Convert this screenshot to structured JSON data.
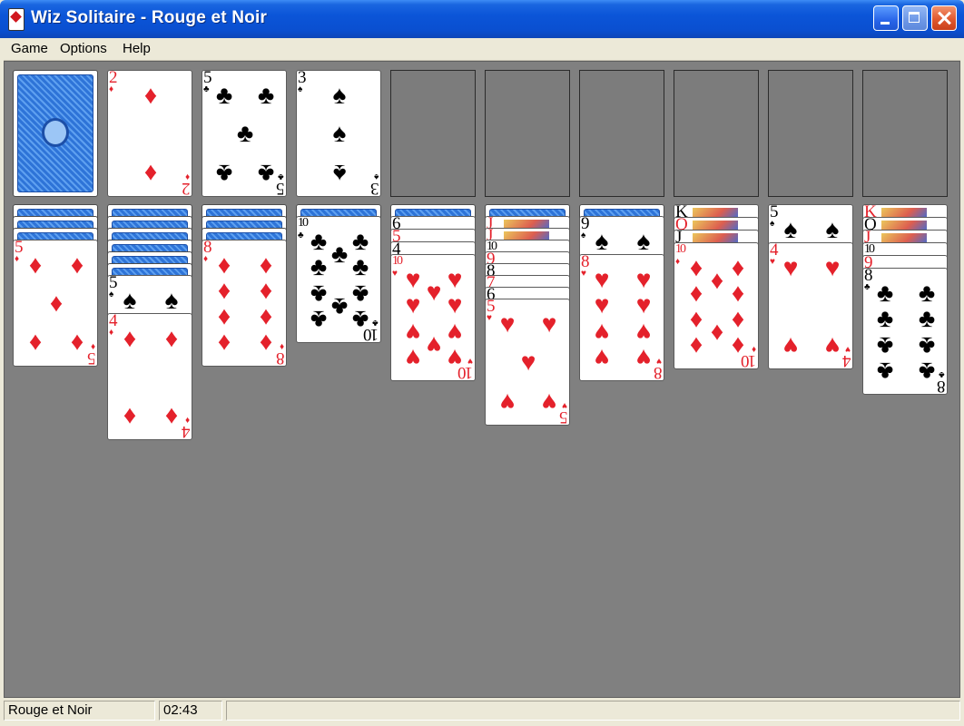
{
  "window": {
    "title": "Wiz Solitaire - Rouge et Noir",
    "controls": [
      "minimize-icon",
      "maximize-icon",
      "close-icon"
    ]
  },
  "menu": {
    "game": "Game",
    "options": "Options",
    "help": "Help"
  },
  "colors": {
    "table": "#808080",
    "red_suit": "#e4212b",
    "black_suit": "#000000",
    "card_back": "#2e74d8",
    "titlebar": "#0b55d8"
  },
  "stock": {
    "face_down": true
  },
  "foundations": [
    {
      "rank": "2",
      "suit": "♦",
      "color": "red"
    },
    {
      "rank": "5",
      "suit": "♣",
      "color": "black"
    },
    {
      "rank": "3",
      "suit": "♠",
      "color": "black"
    },
    null,
    null,
    null,
    null,
    null,
    null
  ],
  "tableau": [
    {
      "face_down": 3,
      "cards": [
        {
          "rank": "5",
          "suit": "♦",
          "color": "red"
        }
      ]
    },
    {
      "face_down": 6,
      "cards": [
        {
          "rank": "5",
          "suit": "♠",
          "color": "black"
        },
        {
          "rank": "4",
          "suit": "♦",
          "color": "red"
        }
      ]
    },
    {
      "face_down": 3,
      "cards": [
        {
          "rank": "8",
          "suit": "♦",
          "color": "red"
        }
      ]
    },
    {
      "face_down": 1,
      "cards": [
        {
          "rank": "10",
          "suit": "♣",
          "color": "black"
        }
      ]
    },
    {
      "face_down": 1,
      "cards": [
        {
          "rank": "6",
          "suit": "♠",
          "color": "black"
        },
        {
          "rank": "5",
          "suit": "♥",
          "color": "red"
        },
        {
          "rank": "4",
          "suit": "♠",
          "color": "black"
        },
        {
          "rank": "10",
          "suit": "♥",
          "color": "red"
        }
      ]
    },
    {
      "face_down": 1,
      "cards": [
        {
          "rank": "J",
          "suit": "♦",
          "color": "red"
        },
        {
          "rank": "J",
          "suit": "♦",
          "color": "red"
        },
        {
          "rank": "10",
          "suit": "♠",
          "color": "black"
        },
        {
          "rank": "9",
          "suit": "♥",
          "color": "red"
        },
        {
          "rank": "8",
          "suit": "♠",
          "color": "black"
        },
        {
          "rank": "7",
          "suit": "♥",
          "color": "red"
        },
        {
          "rank": "6",
          "suit": "♠",
          "color": "black"
        },
        {
          "rank": "5",
          "suit": "♥",
          "color": "red"
        }
      ]
    },
    {
      "face_down": 1,
      "cards": [
        {
          "rank": "9",
          "suit": "♠",
          "color": "black"
        },
        {
          "rank": "8",
          "suit": "♥",
          "color": "red"
        }
      ]
    },
    {
      "face_down": 0,
      "cards": [
        {
          "rank": "K",
          "suit": "♠",
          "color": "black"
        },
        {
          "rank": "Q",
          "suit": "♥",
          "color": "red"
        },
        {
          "rank": "J",
          "suit": "♠",
          "color": "black"
        },
        {
          "rank": "10",
          "suit": "♦",
          "color": "red"
        }
      ]
    },
    {
      "face_down": 0,
      "cards": [
        {
          "rank": "5",
          "suit": "♠",
          "color": "black"
        },
        {
          "rank": "4",
          "suit": "♥",
          "color": "red"
        }
      ]
    },
    {
      "face_down": 0,
      "cards": [
        {
          "rank": "K",
          "suit": "♥",
          "color": "red"
        },
        {
          "rank": "Q",
          "suit": "♠",
          "color": "black"
        },
        {
          "rank": "J",
          "suit": "♥",
          "color": "red"
        },
        {
          "rank": "10",
          "suit": "♠",
          "color": "black"
        },
        {
          "rank": "9",
          "suit": "♥",
          "color": "red"
        },
        {
          "rank": "8",
          "suit": "♣",
          "color": "black"
        }
      ]
    }
  ],
  "status": {
    "game_name": "Rouge et Noir",
    "timer": "02:43",
    "message": ""
  }
}
